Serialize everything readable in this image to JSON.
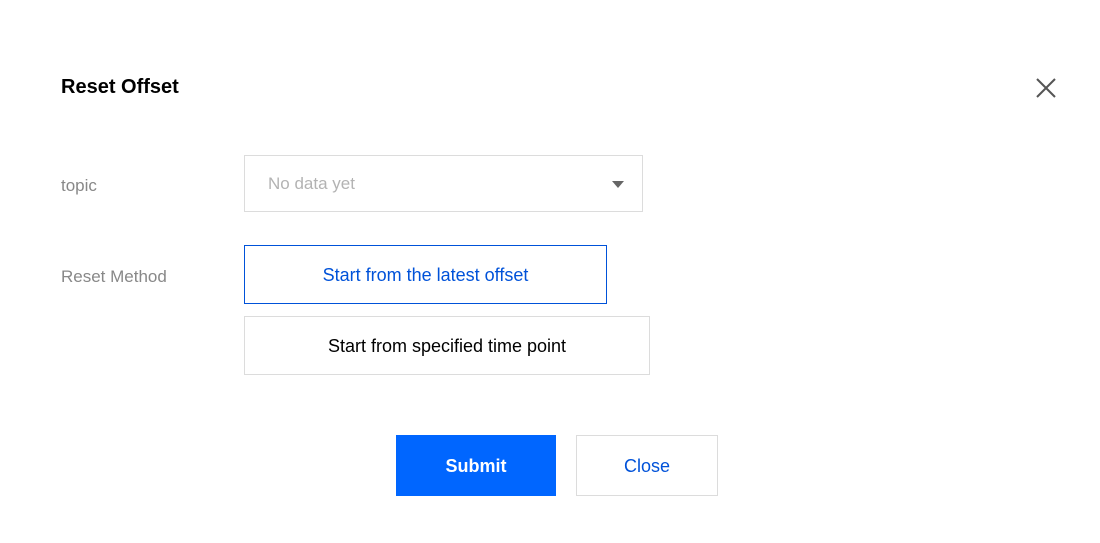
{
  "dialog": {
    "title": "Reset Offset",
    "close_icon": "close-icon"
  },
  "form": {
    "topic": {
      "label": "topic",
      "value": "No data yet",
      "icon": "chevron-down-icon"
    },
    "reset_method": {
      "label": "Reset Method",
      "options": [
        {
          "label": "Start from the latest offset",
          "selected": true
        },
        {
          "label": "Start from specified time point",
          "selected": false
        }
      ]
    }
  },
  "footer": {
    "submit_label": "Submit",
    "close_label": "Close"
  },
  "colors": {
    "primary": "#0066ff",
    "selected_text": "#0052d9",
    "border": "#dcdcdc",
    "label": "#888888"
  }
}
